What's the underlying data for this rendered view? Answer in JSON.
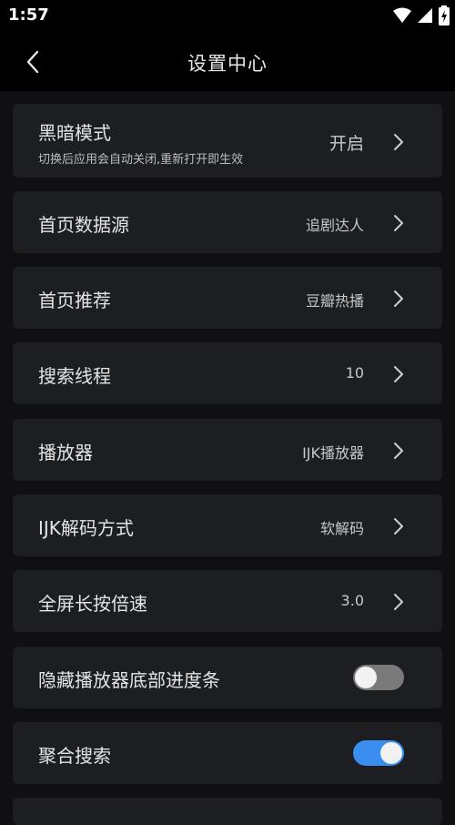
{
  "status": {
    "time": "1:57"
  },
  "header": {
    "title": "设置中心"
  },
  "settings": [
    {
      "label": "黑暗模式",
      "sub": "切换后应用会自动关闭,重新打开即生效",
      "value": "开启"
    },
    {
      "label": "首页数据源",
      "value": "追剧达人"
    },
    {
      "label": "首页推荐",
      "value": "豆瓣热播"
    },
    {
      "label": "搜索线程",
      "value": "10"
    },
    {
      "label": "播放器",
      "value": "IJK播放器"
    },
    {
      "label": "IJK解码方式",
      "value": "软解码"
    },
    {
      "label": "全屏长按倍速",
      "value": "3.0"
    },
    {
      "label": "隐藏播放器底部进度条",
      "toggle": false
    },
    {
      "label": "聚合搜索",
      "toggle": true
    }
  ],
  "colors": {
    "accent": "#3a8ef0",
    "card": "#1d1e21",
    "background": "#101012"
  },
  "icons": {
    "back": "chevron-left-icon",
    "row": "chevron-right-icon"
  }
}
